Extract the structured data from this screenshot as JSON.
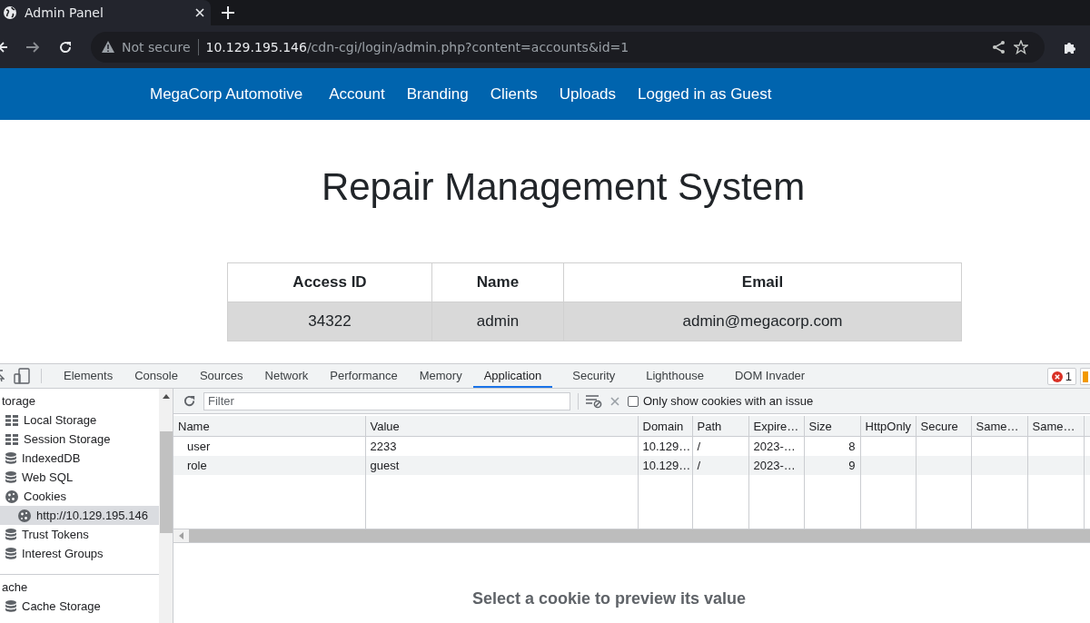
{
  "browser": {
    "tab": {
      "title": "Admin Panel"
    },
    "address": {
      "security": "Not secure",
      "host": "10.129.195.146",
      "path": "/cdn-cgi/login/admin.php?content=accounts&id=1"
    }
  },
  "site": {
    "brand": "MegaCorp Automotive",
    "nav": [
      "Account",
      "Branding",
      "Clients",
      "Uploads",
      "Logged in as Guest"
    ],
    "heading": "Repair Management System",
    "table": {
      "columns": [
        "Access ID",
        "Name",
        "Email"
      ],
      "rows": [
        [
          "34322",
          "admin",
          "admin@megacorp.com"
        ]
      ]
    }
  },
  "devtools": {
    "tabs": [
      {
        "label": "Elements",
        "selected": false
      },
      {
        "label": "Console",
        "selected": false
      },
      {
        "label": "Sources",
        "selected": false
      },
      {
        "label": "Network",
        "selected": false
      },
      {
        "label": "Performance",
        "selected": false
      },
      {
        "label": "Memory",
        "selected": false
      },
      {
        "label": "Application",
        "selected": true
      },
      {
        "label": "Security",
        "selected": false
      },
      {
        "label": "Lighthouse",
        "selected": false
      },
      {
        "label": "DOM Invader",
        "selected": false
      }
    ],
    "error_count": "1",
    "sidebar": [
      {
        "title": "torage",
        "items": [
          {
            "label": "Local Storage",
            "kind": "grid",
            "selected": false
          },
          {
            "label": "Session Storage",
            "kind": "grid",
            "selected": false
          },
          {
            "label": "IndexedDB",
            "kind": "database",
            "selected": false
          },
          {
            "label": "Web SQL",
            "kind": "database",
            "selected": false
          },
          {
            "label": "Cookies",
            "kind": "cookie",
            "selected": false,
            "children": [
              {
                "label": "http://10.129.195.146",
                "kind": "cookie",
                "selected": true
              }
            ]
          },
          {
            "label": "Trust Tokens",
            "kind": "database",
            "selected": false
          },
          {
            "label": "Interest Groups",
            "kind": "database",
            "selected": false
          }
        ]
      },
      {
        "title": "ache",
        "items": [
          {
            "label": "Cache Storage",
            "kind": "database",
            "selected": false
          }
        ]
      }
    ],
    "filter": {
      "placeholder": "Filter"
    },
    "issue_only": {
      "label": "Only show cookies with an issue",
      "checked": false
    },
    "cookies": {
      "columns": [
        "Name",
        "Value",
        "Domain",
        "Path",
        "Expire…",
        "Size",
        "HttpOnly",
        "Secure",
        "Same…",
        "Same…"
      ],
      "rows": [
        [
          "user",
          "2233",
          "10.129…",
          "/",
          "2023-…",
          "8",
          "",
          "",
          "",
          ""
        ],
        [
          "role",
          "guest",
          "10.129…",
          "/",
          "2023-…",
          "9",
          "",
          "",
          "",
          ""
        ]
      ]
    },
    "preview": "Select a cookie to preview its value"
  }
}
